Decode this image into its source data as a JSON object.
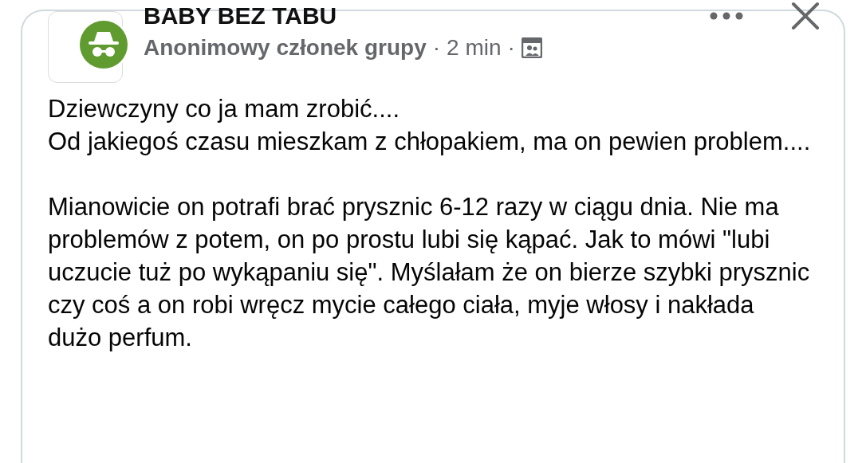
{
  "group": {
    "name": "BABY BEZ TABU"
  },
  "post": {
    "author": "Anonimowy członek grupy",
    "separator_1": "·",
    "time": "2 min",
    "separator_2": "·"
  },
  "body": [
    "Dziewczyny co ja mam zrobić....\nOd jakiegoś czasu mieszkam z chłopakiem, ma on pewien problem....",
    "Mianowicie on potrafi brać prysznic 6-12 razy w ciągu dnia. Nie ma problemów z potem, on po prostu lubi się kąpać. Jak to mówi \"lubi uczucie tuż po wykąpaniu się\". Myślałam że on bierze szybki prysznic czy coś a on robi wręcz mycie całego ciała, myje włosy i nakłada dużo perfum."
  ]
}
